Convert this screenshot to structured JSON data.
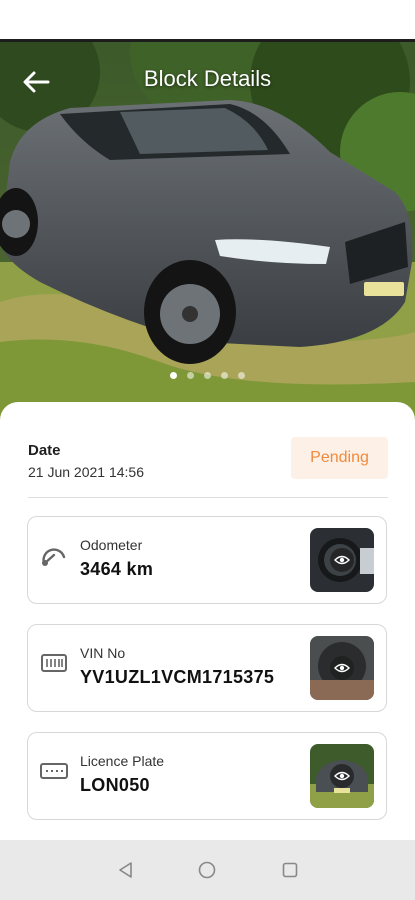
{
  "header": {
    "title": "Block Details",
    "back_icon": "arrow-left-icon"
  },
  "gallery": {
    "image_count": 5,
    "active_index": 0
  },
  "details": {
    "date_label": "Date",
    "date_value": "21 Jun 2021 14:56",
    "status": "Pending",
    "status_color": "#f08a3e",
    "status_bg": "#fdf0e6"
  },
  "items": [
    {
      "icon": "odometer-icon",
      "label": "Odometer",
      "value": "3464 km"
    },
    {
      "icon": "vin-icon",
      "label": "VIN No",
      "value": "YV1UZL1VCM1715375"
    },
    {
      "icon": "licence-plate-icon",
      "label": "Licence Plate",
      "value": "LON050"
    }
  ],
  "navigation": {
    "back": "nav-back-icon",
    "home": "nav-home-icon",
    "recents": "nav-recents-icon"
  }
}
